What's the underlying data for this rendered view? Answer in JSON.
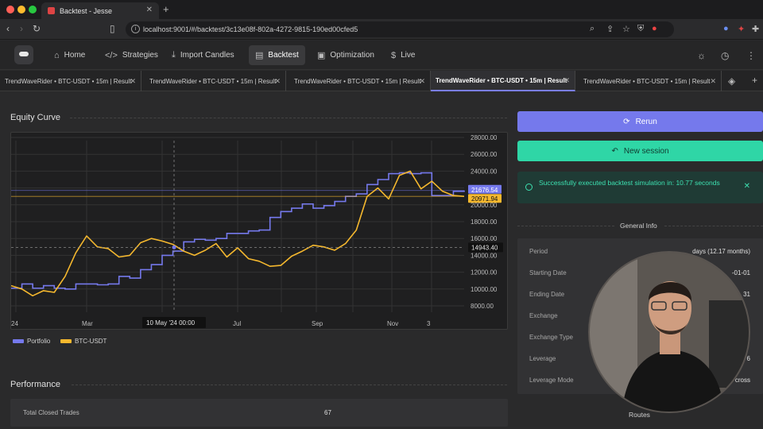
{
  "browser": {
    "tab_title": "Backtest - Jesse",
    "new_tab": "+",
    "url": "localhost:9001/#/backtest/3c13e08f-802a-4272-9815-190ed00cfed5"
  },
  "nav": {
    "items": [
      {
        "label": "Home",
        "icon": "home-icon"
      },
      {
        "label": "Strategies",
        "icon": "code-icon"
      },
      {
        "label": "Import Candles",
        "icon": "download-icon"
      },
      {
        "label": "Backtest",
        "icon": "document-icon"
      },
      {
        "label": "Optimization",
        "icon": "chip-icon"
      },
      {
        "label": "Live",
        "icon": "dollar-icon"
      }
    ],
    "active": "Backtest"
  },
  "result_tabs": [
    {
      "label": "TrendWaveRider • BTC-USDT • 15m | Result"
    },
    {
      "label": "TrendWaveRider • BTC-USDT • 15m | Result"
    },
    {
      "label": "TrendWaveRider • BTC-USDT • 15m | Result"
    },
    {
      "label": "TrendWaveRider • BTC-USDT • 15m | Result"
    },
    {
      "label": "TrendWaveRider • BTC-USDT • 15m | Result"
    }
  ],
  "equity": {
    "title": "Equity Curve",
    "crosshair_label": "10 May '24  00:00",
    "crosshair_value": "14943.40",
    "portfolio_price": "21676.54",
    "btc_price": "20971.94"
  },
  "chart_data": {
    "type": "line",
    "y_ticks": [
      "28000.00",
      "26000.00",
      "24000.00",
      "22000.00",
      "20000.00",
      "18000.00",
      "16000.00",
      "14000.00",
      "12000.00",
      "10000.00",
      "8000.00"
    ],
    "x_ticks": [
      "24",
      "Mar",
      "Jul",
      "Sep",
      "Nov",
      "3"
    ],
    "ylim": [
      8000,
      28000
    ],
    "series": [
      {
        "name": "Portfolio",
        "color": "#7579ec",
        "values": [
          10100,
          10600,
          10100,
          10400,
          10100,
          10000,
          10600,
          10600,
          10500,
          10600,
          11500,
          11300,
          12300,
          12900,
          14000,
          14500,
          15600,
          15900,
          15800,
          16000,
          16600,
          16600,
          16900,
          17000,
          18500,
          19200,
          19600,
          20100,
          19600,
          19900,
          20400,
          21000,
          21300,
          22400,
          23000,
          23700,
          23800,
          23700,
          23800,
          21100,
          21100,
          21600,
          21700
        ]
      },
      {
        "name": "BTC-USDT",
        "color": "#f5b82e",
        "values": [
          10400,
          10000,
          9200,
          9800,
          9600,
          11500,
          14300,
          16300,
          15000,
          14800,
          13800,
          14000,
          15500,
          16000,
          15700,
          15300,
          14500,
          14000,
          14600,
          15400,
          13800,
          14900,
          13600,
          13300,
          12700,
          12800,
          13900,
          14500,
          15200,
          15000,
          14600,
          15400,
          17000,
          21000,
          22000,
          20700,
          23500,
          24000,
          21900,
          22800,
          21600,
          21100,
          21000
        ]
      }
    ],
    "legend_position": "bottom-left"
  },
  "legend": {
    "portfolio": "Portfolio",
    "btc": "BTC-USDT"
  },
  "actions": {
    "rerun": "Rerun",
    "new_session": "New session"
  },
  "alert": {
    "message": "Successfully executed backtest simulation in: 10.77 seconds"
  },
  "general_info": {
    "title": "General Info",
    "rows": [
      {
        "label": "Period",
        "value": "days (12.17 months)"
      },
      {
        "label": "Starting Date",
        "value": "-01-01"
      },
      {
        "label": "Ending Date",
        "value": "31"
      },
      {
        "label": "Exchange",
        "value": ""
      },
      {
        "label": "Exchange Type",
        "value": ""
      },
      {
        "label": "Leverage",
        "value": "6"
      },
      {
        "label": "Leverage Mode",
        "value": "cross"
      }
    ]
  },
  "performance": {
    "title": "Performance",
    "rows": [
      {
        "label": "Total Closed Trades",
        "value": "67"
      }
    ]
  },
  "routes": {
    "title": "Routes"
  }
}
